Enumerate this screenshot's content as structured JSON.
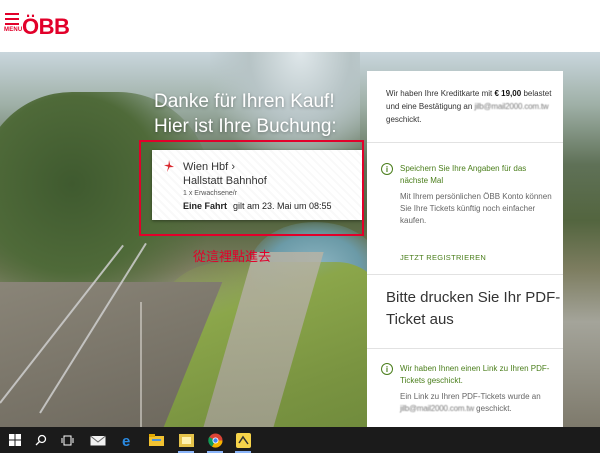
{
  "header": {
    "menu_label": "MENU",
    "logo_text": "ÖBB",
    "brand_color": "#e2002a"
  },
  "hero": {
    "headline_line1": "Danke für Ihren Kauf!",
    "headline_line2": "Hier ist Ihre Buchung:"
  },
  "ticket": {
    "from": "Wien Hbf",
    "to": "Hallstatt Bahnhof",
    "passengers": "1 x Erwachsene/r",
    "type": "Eine Fahrt",
    "validity": "gilt am 23. Mai um 08:55",
    "icon": "pdf-icon"
  },
  "annotation": {
    "text": "從這裡點進去",
    "color": "#e2002a"
  },
  "panel": {
    "payment": {
      "pre": "Wir haben Ihre Kreditkarte mit",
      "amount": "€ 19,00",
      "mid": "belastet und eine Bestätigung an",
      "email": "jilb@mail2000.com.tw",
      "post": "geschickt."
    },
    "save": {
      "title": "Speichern Sie Ihre Angaben für das nächste Mal",
      "desc": "Mit Ihrem persönlichen ÖBB Konto können Sie Ihre Tickets künftig noch einfacher kaufen.",
      "button": "JETZT REGISTRIEREN",
      "icon": "info-icon"
    },
    "print_title": "Bitte drucken Sie Ihr PDF-Ticket aus",
    "link": {
      "title": "Wir haben Ihnen einen Link zu Ihren PDF-Tickets geschickt.",
      "desc_pre": "Ein Link zu Ihren PDF-Tickets wurde an",
      "email": "jilb@mail2000.com.tw",
      "desc_post": "geschickt.",
      "icon": "info-icon"
    },
    "accent_color": "#4a7e1b"
  },
  "taskbar": {
    "icons": [
      "windows-start-icon",
      "search-icon",
      "task-view-icon",
      "mail-icon",
      "edge-icon",
      "file-explorer-icon",
      "sticky-icon",
      "chrome-icon",
      "app-icon"
    ]
  }
}
